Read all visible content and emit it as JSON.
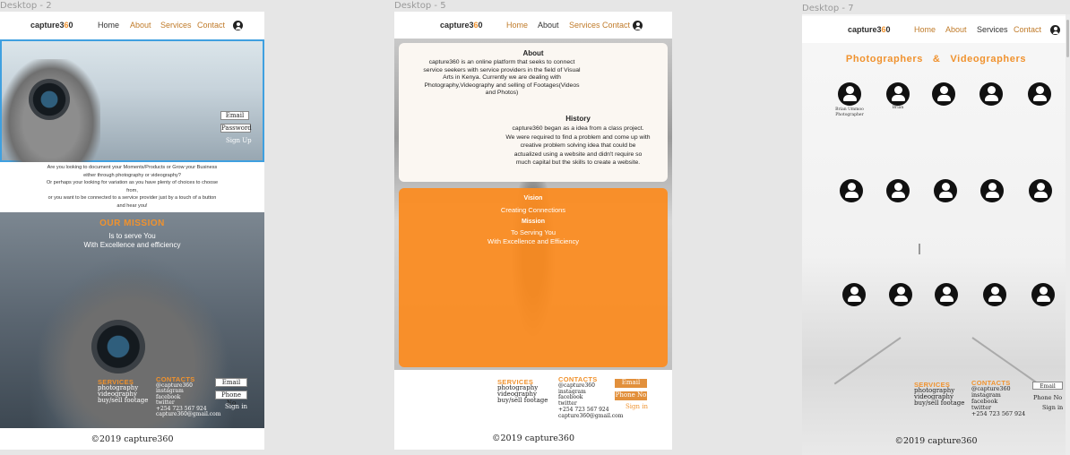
{
  "frames": {
    "f2": {
      "label": "Desktop - 2",
      "nav": {
        "logo_pre": "capture3",
        "logo_o": "6",
        "logo_post": "0",
        "items": [
          "Home",
          "About",
          "Services",
          "Contact"
        ]
      },
      "hero": {
        "email_label": "Email",
        "password_label": "Password",
        "signup_label": "Sign Up"
      },
      "intro": [
        "Are you looking to document your Moments/Products or Grow your Business",
        "either through photography or videography?",
        "Or perhaps your looking for variation as you have plenty of choices to choose",
        "from,",
        "or you want to be connected to a service provider just by a touch of a button",
        "and hear you!"
      ],
      "mission": {
        "title": "OUR MISSION",
        "line1": "Is to serve You",
        "line2": "With Excellence and efficiency"
      },
      "footer": {
        "services_title": "SERVICES",
        "services": [
          "photography",
          "videography",
          "buy/sell footage"
        ],
        "contacts_title": "CONTACTS",
        "contacts": [
          "@capture360",
          "instagram",
          "facebook",
          "twitter",
          "+254 723 567 924",
          "capture360@gmail.com"
        ],
        "email_label": "Email",
        "phone_label": "Phone No",
        "signin_label": "Sign in"
      },
      "copyright": "©2019 capture360"
    },
    "f5": {
      "label": "Desktop - 5",
      "nav": {
        "logo_pre": "capture3",
        "logo_o": "6",
        "logo_post": "0",
        "items": [
          "Home",
          "About",
          "Services",
          "Contact"
        ]
      },
      "about_title": "About",
      "about_text": [
        "capture360 is an online platform that seeks to connect",
        "service seekers with service providers in the field of Visual",
        "Arts in Kenya. Currently we are dealing with",
        "Photography,Videography and selling of Footages(Videos",
        "and Photos)"
      ],
      "history_title": "History",
      "history_text": [
        "capture360 began as a idea from a class project.",
        "We were required to find a problem and come up with",
        "creative problem solving idea that could be",
        "actualized using a website and didn't require so",
        "much capital but the skills to create a website."
      ],
      "vision_title": "Vision",
      "vision_text": "Creating Connections",
      "mission_title": "Mission",
      "mission_line1": "To Serving You",
      "mission_line2": "With Excellence and Efficiency",
      "footer": {
        "services_title": "SERVICES",
        "services": [
          "photography",
          "videography",
          "buy/sell footage"
        ],
        "contacts_title": "CONTACTS",
        "contacts": [
          "@capture360",
          "instagram",
          "facebook",
          "twitter",
          "+254 723 567 924",
          "capture360@gmail.com"
        ],
        "email_label": "Email",
        "phone_label": "Phone No",
        "signin_label": "Sign in"
      },
      "copyright": "©2019 capture360"
    },
    "f7": {
      "label": "Desktop - 7",
      "nav": {
        "logo_pre": "capture3",
        "logo_o": "6",
        "logo_post": "0",
        "items": [
          "Home",
          "About",
          "Services",
          "Contact"
        ]
      },
      "heading": "Photographers   &   Videographers",
      "first_caption_1": "Brian Ummoo",
      "first_caption_2": "Photographer",
      "second_caption": "Brian",
      "footer": {
        "services_title": "SERVICES",
        "services": [
          "photography",
          "videography",
          "buy/sell footage"
        ],
        "contacts_title": "CONTACTS",
        "contacts": [
          "@capture360",
          "instagram",
          "facebook",
          "twitter",
          "+254 723 567 924"
        ],
        "email_label": "Email",
        "phone_label": "Phone No",
        "signin_label": "Sign in"
      },
      "copyright": "©2019 capture360"
    }
  },
  "colors": {
    "accent": "#f0922e",
    "orange_panel": "#fb8c22",
    "canvas": "#e6e6e6",
    "selection": "#3fa0e0"
  }
}
